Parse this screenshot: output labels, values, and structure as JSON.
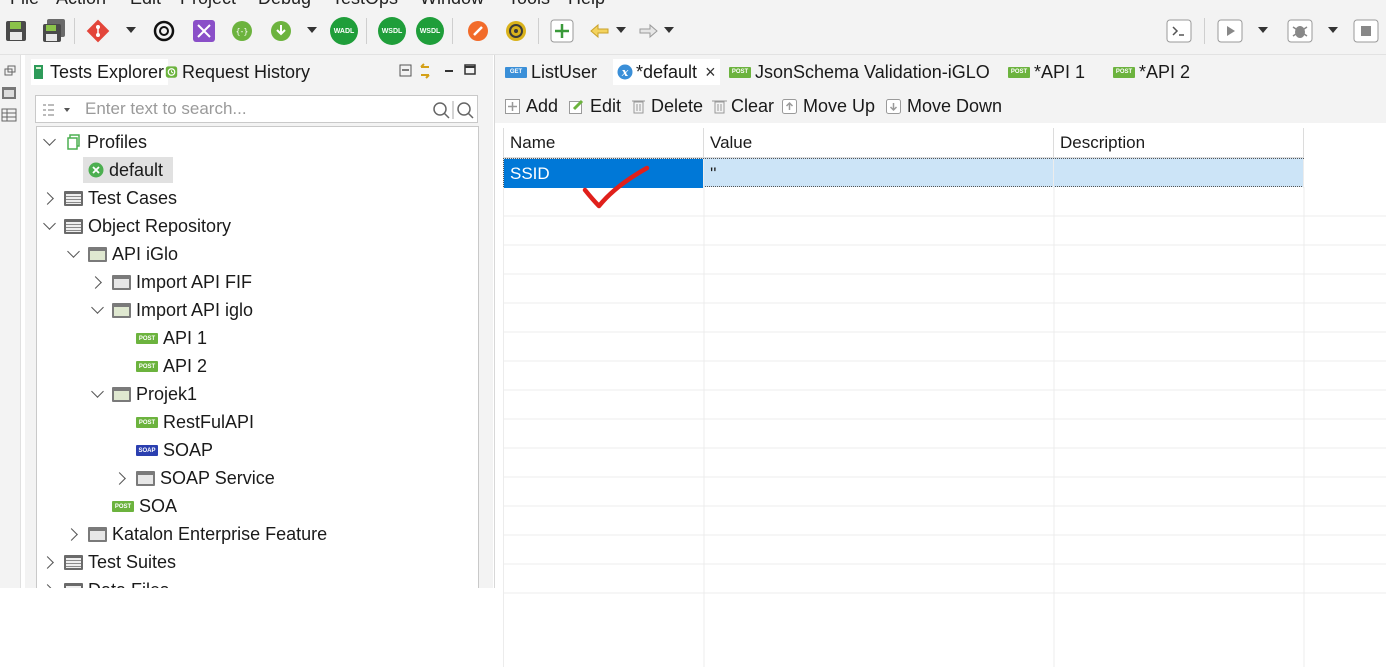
{
  "menubar": {
    "items": [
      "File",
      "Action",
      "Edit",
      "Project",
      "Debug",
      "TestOps",
      "Window",
      "Tools",
      "Help"
    ]
  },
  "toolbar": {
    "icons": [
      "save-icon",
      "save-all-icon",
      "git-icon",
      "openai-icon",
      "self-healing-icon",
      "spy-icon",
      "record-icon",
      "wadl-icon",
      "wsdl-icon",
      "wsdl-import-icon",
      "rocket-icon",
      "plugin-icon",
      "add-icon",
      "back-arrow-icon",
      "forward-arrow-icon",
      "terminal-icon",
      "run-icon",
      "debug-icon",
      "stop-icon"
    ],
    "texts": {
      "wadl": "WADL",
      "wsdl": "WSDL",
      "wsdl2": "WSDL"
    }
  },
  "left_panel": {
    "tabs": [
      {
        "label": "Tests Explorer",
        "active": true
      },
      {
        "label": "Request History",
        "active": false
      }
    ],
    "search": {
      "placeholder": "Enter text to search...",
      "value": ""
    },
    "tree": [
      {
        "label": "Profiles",
        "icon": "profiles-icon",
        "expanded": true
      },
      {
        "label": "default",
        "icon": "profile-x-icon",
        "selected": true
      },
      {
        "label": "Test Cases",
        "icon": "test-cases-icon",
        "expanded": false
      },
      {
        "label": "Object Repository",
        "icon": "repository-icon",
        "expanded": true
      },
      {
        "label": "API iGlo",
        "icon": "folder-icon",
        "expanded": true
      },
      {
        "label": "Import API FIF",
        "icon": "folder-icon",
        "expanded": false
      },
      {
        "label": "Import API iglo",
        "icon": "folder-icon",
        "expanded": true
      },
      {
        "label": "API 1",
        "icon": "post-icon",
        "badge": "POST"
      },
      {
        "label": "API 2",
        "icon": "post-icon",
        "badge": "POST"
      },
      {
        "label": "Projek1",
        "icon": "folder-icon",
        "expanded": true
      },
      {
        "label": "RestFulAPI",
        "icon": "post-icon",
        "badge": "POST"
      },
      {
        "label": "SOAP",
        "icon": "soap-icon",
        "badge": "SOAP"
      },
      {
        "label": "SOAP Service",
        "icon": "folder-icon",
        "expanded": false
      },
      {
        "label": "SOA",
        "icon": "post-icon",
        "badge": "POST"
      },
      {
        "label": "Katalon Enterprise Feature",
        "icon": "folder-icon",
        "expanded": false
      },
      {
        "label": "Test Suites",
        "icon": "test-suites-icon",
        "expanded": false
      },
      {
        "label": "Data Files",
        "icon": "data-files-icon",
        "expanded": false
      }
    ]
  },
  "editor": {
    "tabs": [
      {
        "label": "ListUser",
        "badge": "GET"
      },
      {
        "label": "*default",
        "badge": "x",
        "active": true,
        "close": "×"
      },
      {
        "label": "JsonSchema Validation-iGLO",
        "badge": "POST"
      },
      {
        "label": "*API 1",
        "badge": "POST"
      },
      {
        "label": "*API 2",
        "badge": "POST"
      }
    ],
    "actions": [
      "Add",
      "Edit",
      "Delete",
      "Clear",
      "Move Up",
      "Move Down"
    ],
    "table": {
      "columns": [
        "Name",
        "Value",
        "Description"
      ],
      "rows": [
        {
          "name": "SSID",
          "value": "''",
          "description": ""
        }
      ]
    },
    "colors": {
      "selection": "#0078d7",
      "row_highlight": "#cce4f7",
      "annotation": "#e0201b"
    }
  }
}
